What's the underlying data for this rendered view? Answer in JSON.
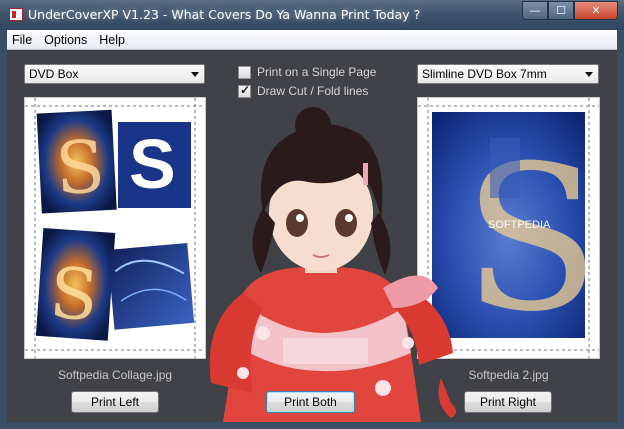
{
  "window": {
    "title": "UnderCoverXP V1.23 - What Covers Do Ya Wanna Print Today ?",
    "controls": {
      "minimize": "—",
      "maximize": "☐",
      "close": "✕"
    }
  },
  "menu": {
    "items": [
      "File",
      "Options",
      "Help"
    ]
  },
  "left_panel": {
    "cover_type": "DVD Box",
    "image_name": "Softpedia Collage.jpg",
    "print_button": "Print Left"
  },
  "center": {
    "single_page": {
      "label": "Print on a Single Page",
      "checked": false
    },
    "cut_lines": {
      "label": "Draw Cut / Fold lines",
      "checked": true
    },
    "print_button": "Print Both"
  },
  "right_panel": {
    "cover_type": "Slimline DVD Box 7mm",
    "image_name": "Softpedia 2.jpg",
    "print_button": "Print Right",
    "image_overlay_text": "SOFTPEDIA"
  },
  "colors": {
    "window_bg": "#404247",
    "caption_text": "#c8c8c8",
    "accent_blue": "#1d4fa8"
  }
}
